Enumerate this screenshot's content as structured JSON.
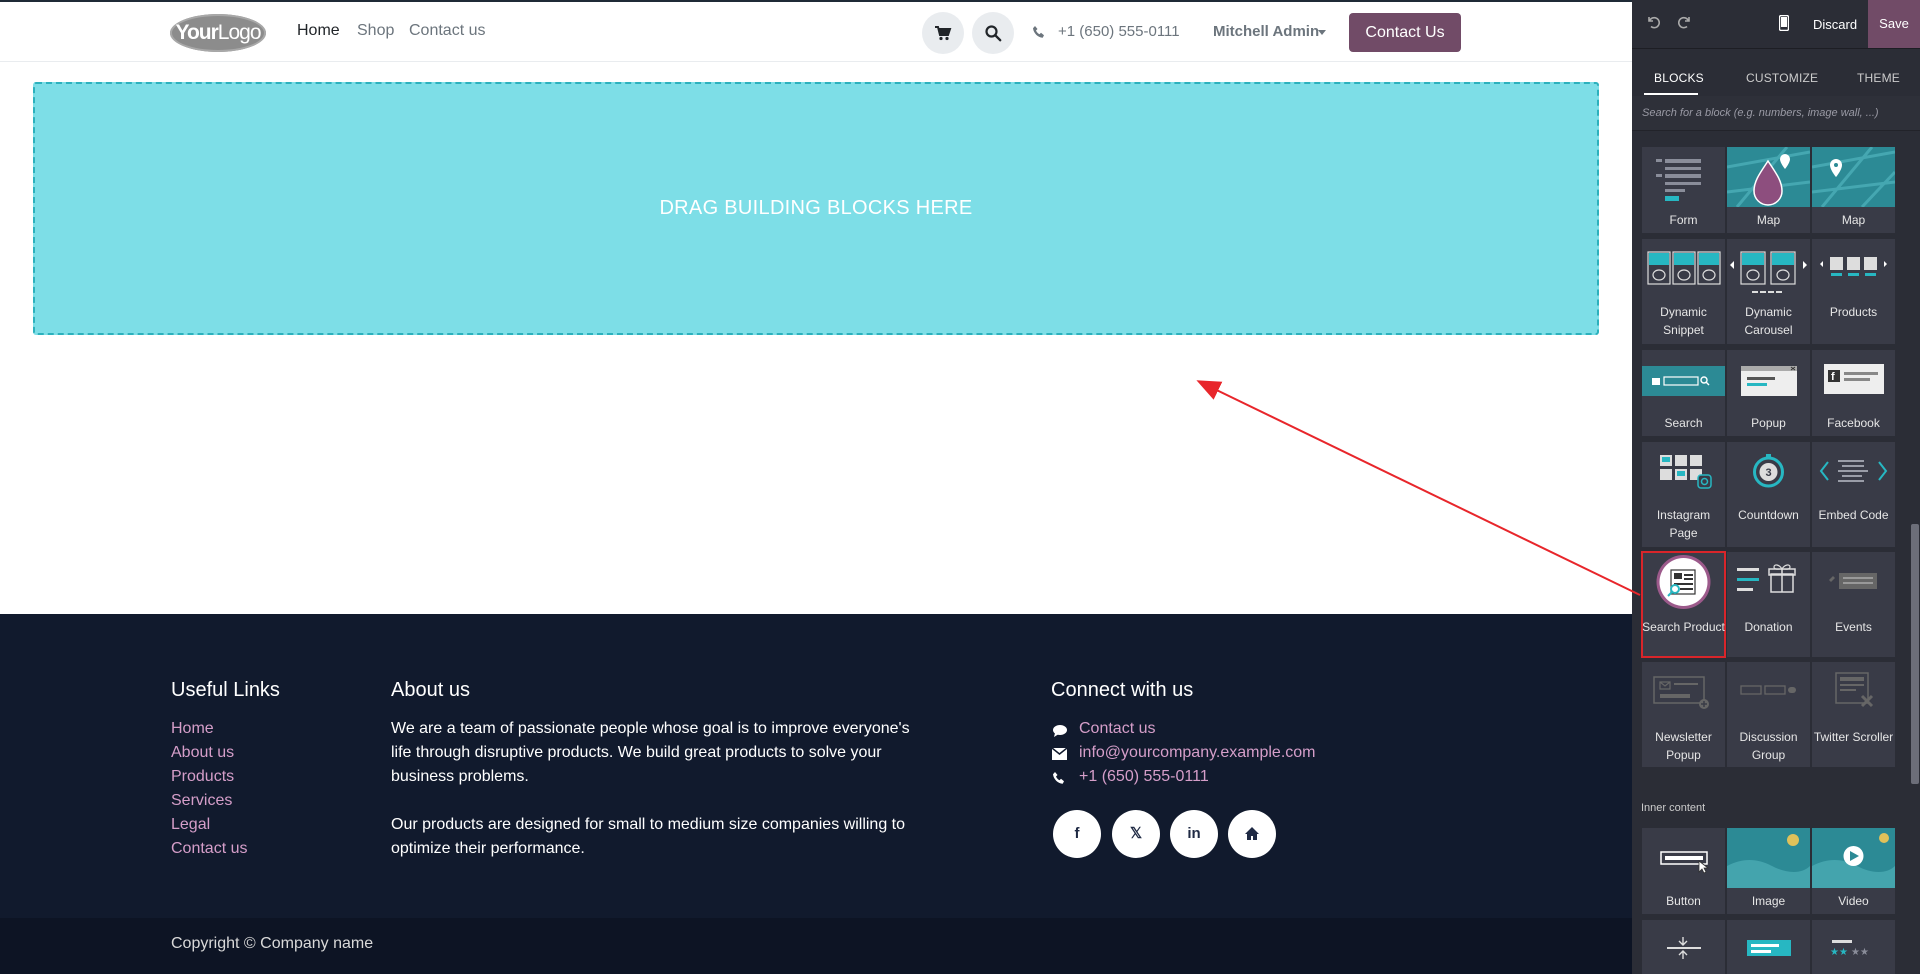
{
  "header": {
    "logo_text_bold": "Your",
    "logo_text": "Logo",
    "nav": [
      "Home",
      "Shop",
      "Contact us"
    ],
    "phone": "+1 (650) 555-0111",
    "user": "Mitchell Admin",
    "cta": "Contact Us"
  },
  "dropzone": {
    "text": "DRAG BUILDING BLOCKS HERE"
  },
  "footer": {
    "useful_links_title": "Useful Links",
    "useful_links": [
      "Home",
      "About us",
      "Products",
      "Services",
      "Legal",
      "Contact us"
    ],
    "about_title": "About us",
    "about_p1": "We are a team of passionate people whose goal is to improve everyone's life through disruptive products. We build great products to solve your business problems.",
    "about_p2": "Our products are designed for small to medium size companies willing to optimize their performance.",
    "connect_title": "Connect with us",
    "connect_contact": "Contact us",
    "connect_email": "info@yourcompany.example.com",
    "connect_phone": "+1 (650) 555-0111",
    "social_icons": [
      "facebook-icon",
      "x-twitter-icon",
      "linkedin-icon",
      "home-icon"
    ],
    "copyright": "Copyright © Company name"
  },
  "editor": {
    "discard": "Discard",
    "save": "Save",
    "tabs": [
      "BLOCKS",
      "CUSTOMIZE",
      "THEME"
    ],
    "search_placeholder": "Search for a block (e.g. numbers, image wall, ...)",
    "blocks": [
      {
        "label": "Form"
      },
      {
        "label": "Map"
      },
      {
        "label": "Map"
      },
      {
        "label": "Dynamic Snippet"
      },
      {
        "label": "Dynamic Carousel"
      },
      {
        "label": "Products"
      },
      {
        "label": "Search"
      },
      {
        "label": "Popup"
      },
      {
        "label": "Facebook"
      },
      {
        "label": "Instagram Page"
      },
      {
        "label": "Countdown"
      },
      {
        "label": "Embed Code"
      },
      {
        "label": "Search Product"
      },
      {
        "label": "Donation"
      },
      {
        "label": "Events"
      },
      {
        "label": "Newsletter Popup"
      },
      {
        "label": "Discussion Group"
      },
      {
        "label": "Twitter Scroller"
      }
    ],
    "inner_content_title": "Inner content",
    "inner_blocks": [
      {
        "label": "Button"
      },
      {
        "label": "Image"
      },
      {
        "label": "Video"
      }
    ],
    "countdown_number": "3"
  },
  "colors": {
    "brand": "#714b67",
    "dropzone": "#7ddee7",
    "footer_bg": "#111a2d",
    "link": "#d59ec9",
    "panel_bg": "#2b2d36",
    "highlight": "#d9252a"
  }
}
